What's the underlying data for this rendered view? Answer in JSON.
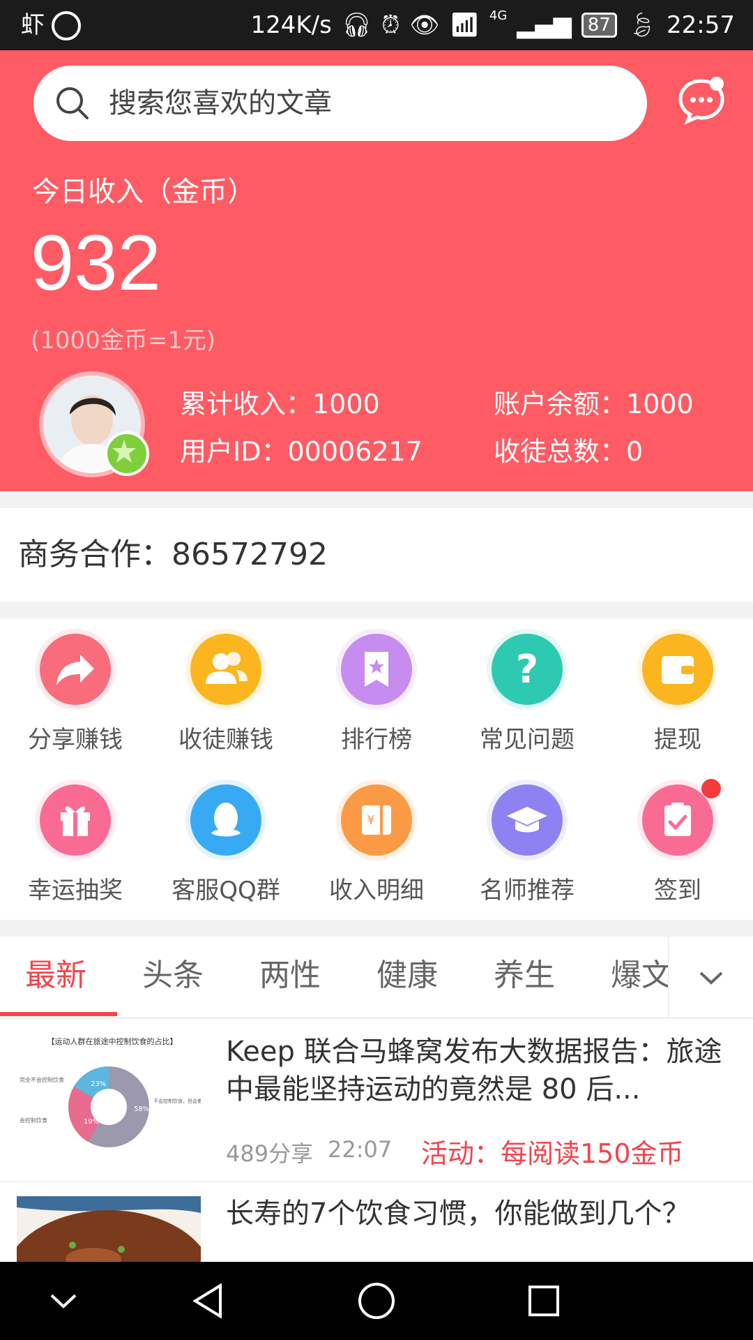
{
  "status_bar": {
    "app_icon": "虾",
    "speed": "124K/s",
    "network": "4G",
    "battery": "87",
    "time": "22:57"
  },
  "header": {
    "search_placeholder": "搜索您喜欢的文章",
    "income_label": "今日收入（金币）",
    "income_value": "932",
    "rate_note": "(1000金币=1元)",
    "stats": {
      "total_income": "累计收入：1000",
      "balance": "账户余额：1000",
      "user_id": "用户ID：00006217",
      "apprentices": "收徒总数：0"
    }
  },
  "business": {
    "text": "商务合作：86572792"
  },
  "grid": [
    {
      "label": "分享赚钱",
      "icon": "share-icon",
      "color": "#f96c7c",
      "ring": "#ffc3cb"
    },
    {
      "label": "收徒赚钱",
      "icon": "users-icon",
      "color": "#fbb51f",
      "ring": "#ffe2a6"
    },
    {
      "label": "排行榜",
      "icon": "ranking-icon",
      "color": "#c68cf0",
      "ring": "#e7ccfa"
    },
    {
      "label": "常见问题",
      "icon": "question-icon",
      "color": "#2ec9b1",
      "ring": "#b5efe6"
    },
    {
      "label": "提现",
      "icon": "wallet-icon",
      "color": "#fbb51f",
      "ring": "#ffe2a6"
    },
    {
      "label": "幸运抽奖",
      "icon": "gift-icon",
      "color": "#fa6b93",
      "ring": "#ffc6d6"
    },
    {
      "label": "客服QQ群",
      "icon": "qq-icon",
      "color": "#38aaf4",
      "ring": "#b9e0fb"
    },
    {
      "label": "收入明细",
      "icon": "ledger-icon",
      "color": "#fb9a45",
      "ring": "#ffd5b0"
    },
    {
      "label": "名师推荐",
      "icon": "graduation-cap-icon",
      "color": "#8e82f3",
      "ring": "#d3cdfa"
    },
    {
      "label": "签到",
      "icon": "checkin-icon",
      "color": "#fa6b93",
      "ring": "#ffc6d6"
    }
  ],
  "tabs": [
    "最新",
    "头条",
    "两性",
    "健康",
    "养生",
    "爆文"
  ],
  "articles": [
    {
      "title": "Keep 联合马蜂窝发布大数据报告：旅途中最能坚持运动的竟然是 80 后...",
      "shares": "489分享",
      "time": "22:07",
      "promo": "活动：每阅读150金币",
      "thumb_title": "【运动人群在旅途中控制饮食的占比】",
      "thumb_labels": [
        "完全不会控制饮食",
        "会控制饮食",
        "不会控制饮食，但会着手不健康的食物"
      ],
      "thumb_values": [
        "23%",
        "19%",
        "58%"
      ]
    },
    {
      "title": "长寿的7个饮食习惯，你能做到几个？"
    }
  ]
}
